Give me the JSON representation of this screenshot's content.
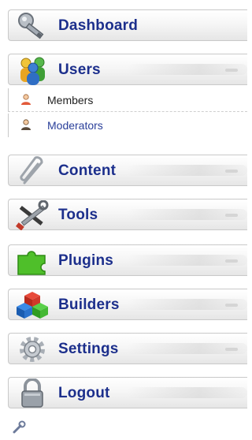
{
  "menu": {
    "dashboard": {
      "label": "Dashboard",
      "icon": "key-icon"
    },
    "users": {
      "label": "Users",
      "icon": "users-group-icon",
      "submenu": [
        {
          "label": "Members",
          "icon": "member-icon"
        },
        {
          "label": "Moderators",
          "icon": "moderator-icon"
        }
      ]
    },
    "content": {
      "label": "Content",
      "icon": "paperclip-icon"
    },
    "tools": {
      "label": "Tools",
      "icon": "tools-icon"
    },
    "plugins": {
      "label": "Plugins",
      "icon": "puzzle-icon"
    },
    "builders": {
      "label": "Builders",
      "icon": "blocks-icon"
    },
    "settings": {
      "label": "Settings",
      "icon": "gear-icon"
    },
    "logout": {
      "label": "Logout",
      "icon": "lock-icon"
    }
  },
  "colors": {
    "label": "#1c2f8c",
    "active_sub": "#2a3f9a",
    "border": "#c9c9c9"
  },
  "footer": {
    "icon": "wrench-icon"
  }
}
